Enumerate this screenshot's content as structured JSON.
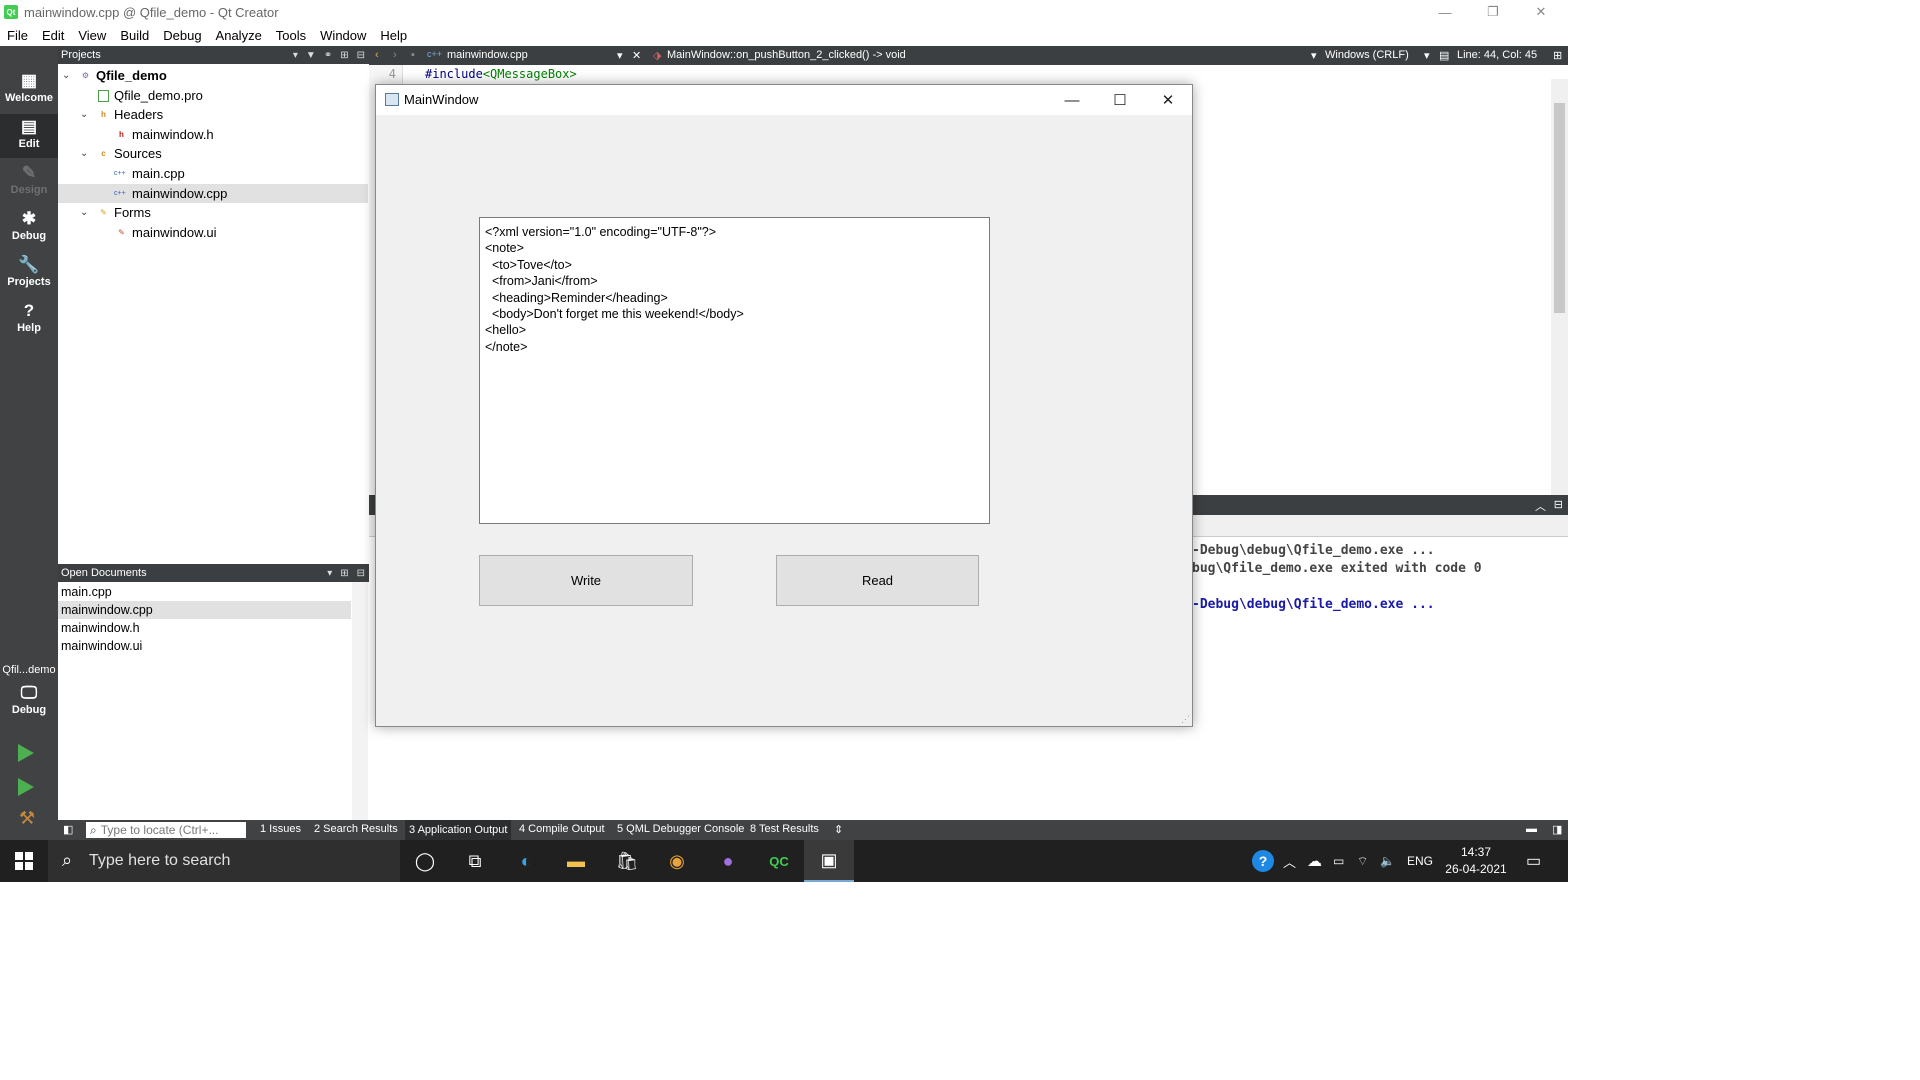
{
  "window": {
    "title": "mainwindow.cpp @ Qfile_demo - Qt Creator",
    "controls": {
      "minimize": "—",
      "restore": "❐",
      "close": "✕"
    }
  },
  "menu": [
    "File",
    "Edit",
    "View",
    "Build",
    "Debug",
    "Analyze",
    "Tools",
    "Window",
    "Help"
  ],
  "modes": [
    {
      "label": "Welcome",
      "icon": "grid-icon",
      "glyph": "▦"
    },
    {
      "label": "Edit",
      "icon": "edit-icon",
      "glyph": "▤"
    },
    {
      "label": "Design",
      "icon": "design-icon",
      "glyph": "✎"
    },
    {
      "label": "Debug",
      "icon": "bug-icon",
      "glyph": "✱"
    },
    {
      "label": "Projects",
      "icon": "wrench-icon",
      "glyph": "🔧"
    },
    {
      "label": "Help",
      "icon": "help-icon",
      "glyph": "?"
    }
  ],
  "kit": {
    "project": "Qfil...demo",
    "build": "Debug"
  },
  "projects_panel": {
    "header": "Projects",
    "tree": [
      {
        "label": "Qfile_demo",
        "level": 0,
        "arrow": "⌄",
        "icon": "project-icon",
        "glyph": "⚙"
      },
      {
        "label": "Qfile_demo.pro",
        "level": 1,
        "arrow": "",
        "icon": "pro-file-icon",
        "glyph": "▭"
      },
      {
        "label": "Headers",
        "level": 1,
        "arrow": "⌄",
        "icon": "headers-folder-icon",
        "glyph": "h"
      },
      {
        "label": "mainwindow.h",
        "level": 2,
        "arrow": "",
        "icon": "header-file-icon",
        "glyph": "h"
      },
      {
        "label": "Sources",
        "level": 1,
        "arrow": "⌄",
        "icon": "sources-folder-icon",
        "glyph": "c"
      },
      {
        "label": "main.cpp",
        "level": 2,
        "arrow": "",
        "icon": "cpp-file-icon",
        "glyph": "c++"
      },
      {
        "label": "mainwindow.cpp",
        "level": 2,
        "arrow": "",
        "icon": "cpp-file-icon",
        "glyph": "c++"
      },
      {
        "label": "Forms",
        "level": 1,
        "arrow": "⌄",
        "icon": "forms-folder-icon",
        "glyph": "✎"
      },
      {
        "label": "mainwindow.ui",
        "level": 2,
        "arrow": "",
        "icon": "ui-file-icon",
        "glyph": "✎"
      }
    ]
  },
  "open_documents": {
    "header": "Open Documents",
    "items": [
      "main.cpp",
      "mainwindow.cpp",
      "mainwindow.h",
      "mainwindow.ui"
    ]
  },
  "editor": {
    "file": "mainwindow.cpp",
    "symbol": "MainWindow::on_pushButton_2_clicked() -> void",
    "line_ending": "Windows (CRLF)",
    "position": "Line: 44, Col: 45",
    "line_number": "4",
    "code_include": "#include",
    "code_header": "<QMessageBox>"
  },
  "output": {
    "line1": "-Debug\\debug\\Qfile_demo.exe ...",
    "line2": "bug\\Qfile_demo.exe exited with code 0",
    "line3": "-Debug\\debug\\Qfile_demo.exe ..."
  },
  "outputbar": {
    "locator_placeholder": "Type to locate (Ctrl+...",
    "tabs": [
      "1  Issues",
      "2  Search Results",
      "3  Application Output",
      "4  Compile Output",
      "5  QML Debugger Console",
      "8  Test Results"
    ]
  },
  "mainwindow": {
    "title": "MainWindow",
    "text_content": "<?xml version=\"1.0\" encoding=\"UTF-8\"?>\n<note>\n  <to>Tove</to>\n  <from>Jani</from>\n  <heading>Reminder</heading>\n  <body>Don't forget me this weekend!</body>\n<hello>\n</note>",
    "write_label": "Write",
    "read_label": "Read"
  },
  "taskbar": {
    "search_placeholder": "Type here to search",
    "language": "ENG",
    "time": "14:37",
    "date": "26-04-2021",
    "apps": [
      "cortana-icon",
      "task-view-icon",
      "edge-icon",
      "file-explorer-icon",
      "store-icon",
      "chrome-icon",
      "github-icon",
      "qt-creator-icon",
      "mainwindow-app-icon"
    ]
  }
}
